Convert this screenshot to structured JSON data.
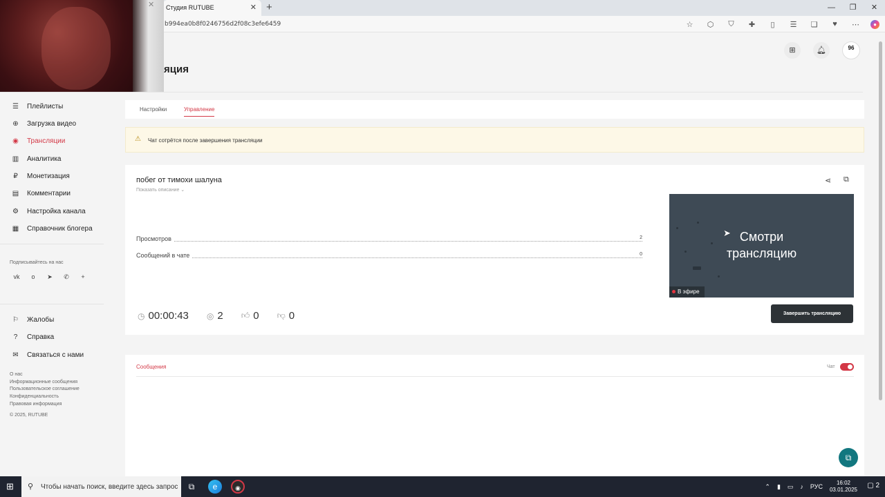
{
  "browser": {
    "tab_title": "Студия RUTUBE",
    "tab_close": "✕",
    "new_tab": "+",
    "url": "b994ea0b8f0246756d2f08c3efe6459",
    "window_controls": [
      "—",
      "❐",
      "✕"
    ]
  },
  "header": {
    "page_title_partial": "яция",
    "avatar_text": "96"
  },
  "sidebar": {
    "items": [
      {
        "label": "Плейлисты",
        "icon": "list-icon"
      },
      {
        "label": "Загрузка видео",
        "icon": "upload-icon"
      },
      {
        "label": "Трансляции",
        "icon": "broadcast-icon",
        "active": true
      },
      {
        "label": "Аналитика",
        "icon": "analytics-icon"
      },
      {
        "label": "Монетизация",
        "icon": "money-icon"
      },
      {
        "label": "Комментарии",
        "icon": "comments-icon"
      },
      {
        "label": "Настройка канала",
        "icon": "gear-icon"
      },
      {
        "label": "Справочник блогера",
        "icon": "book-icon"
      }
    ],
    "subscribe_label": "Подписывайтесь на нас",
    "socials": [
      "vk-icon",
      "ok-icon",
      "telegram-icon",
      "viber-icon",
      "plus-icon"
    ],
    "bottom_items": [
      {
        "label": "Жалобы",
        "icon": "flag-icon"
      },
      {
        "label": "Справка",
        "icon": "help-icon"
      },
      {
        "label": "Связаться с нами",
        "icon": "mail-icon"
      }
    ],
    "footer_links": [
      "О нас",
      "Информационные сообщения",
      "Пользовательское соглашение",
      "Конфиденциальность",
      "Правовая информация",
      "© 2025, RUTUBE"
    ]
  },
  "tabs": {
    "settings": "Настройки",
    "management": "Управление"
  },
  "notice": {
    "text": "Чат сотрётся после завершения трансляции"
  },
  "stream": {
    "title": "побег от тимохи шалуна",
    "show_description": "Показать описание ⌄",
    "stats": [
      {
        "label": "Просмотров",
        "value": "2"
      },
      {
        "label": "Сообщений в чате",
        "value": "0"
      }
    ],
    "duration": "00:00:43",
    "viewers": "2",
    "likes": "0",
    "dislikes": "0",
    "preview_line1": "Смотри",
    "preview_line2": "трансляцию",
    "live_badge": "В эфире",
    "end_button": "Завершить трансляцию"
  },
  "messages": {
    "tab": "Сообщения",
    "chat_label": "Чат",
    "chat_enabled": true
  },
  "taskbar": {
    "search_placeholder": "Чтобы начать поиск, введите здесь запрос",
    "lang": "РУС",
    "time": "16:02",
    "date": "03.01.2025",
    "notifications": "2"
  },
  "colors": {
    "accent": "#d33846",
    "dark_button": "#2d3236",
    "preview_bg": "#3e4a55",
    "notice_bg": "#fdf8e7"
  }
}
